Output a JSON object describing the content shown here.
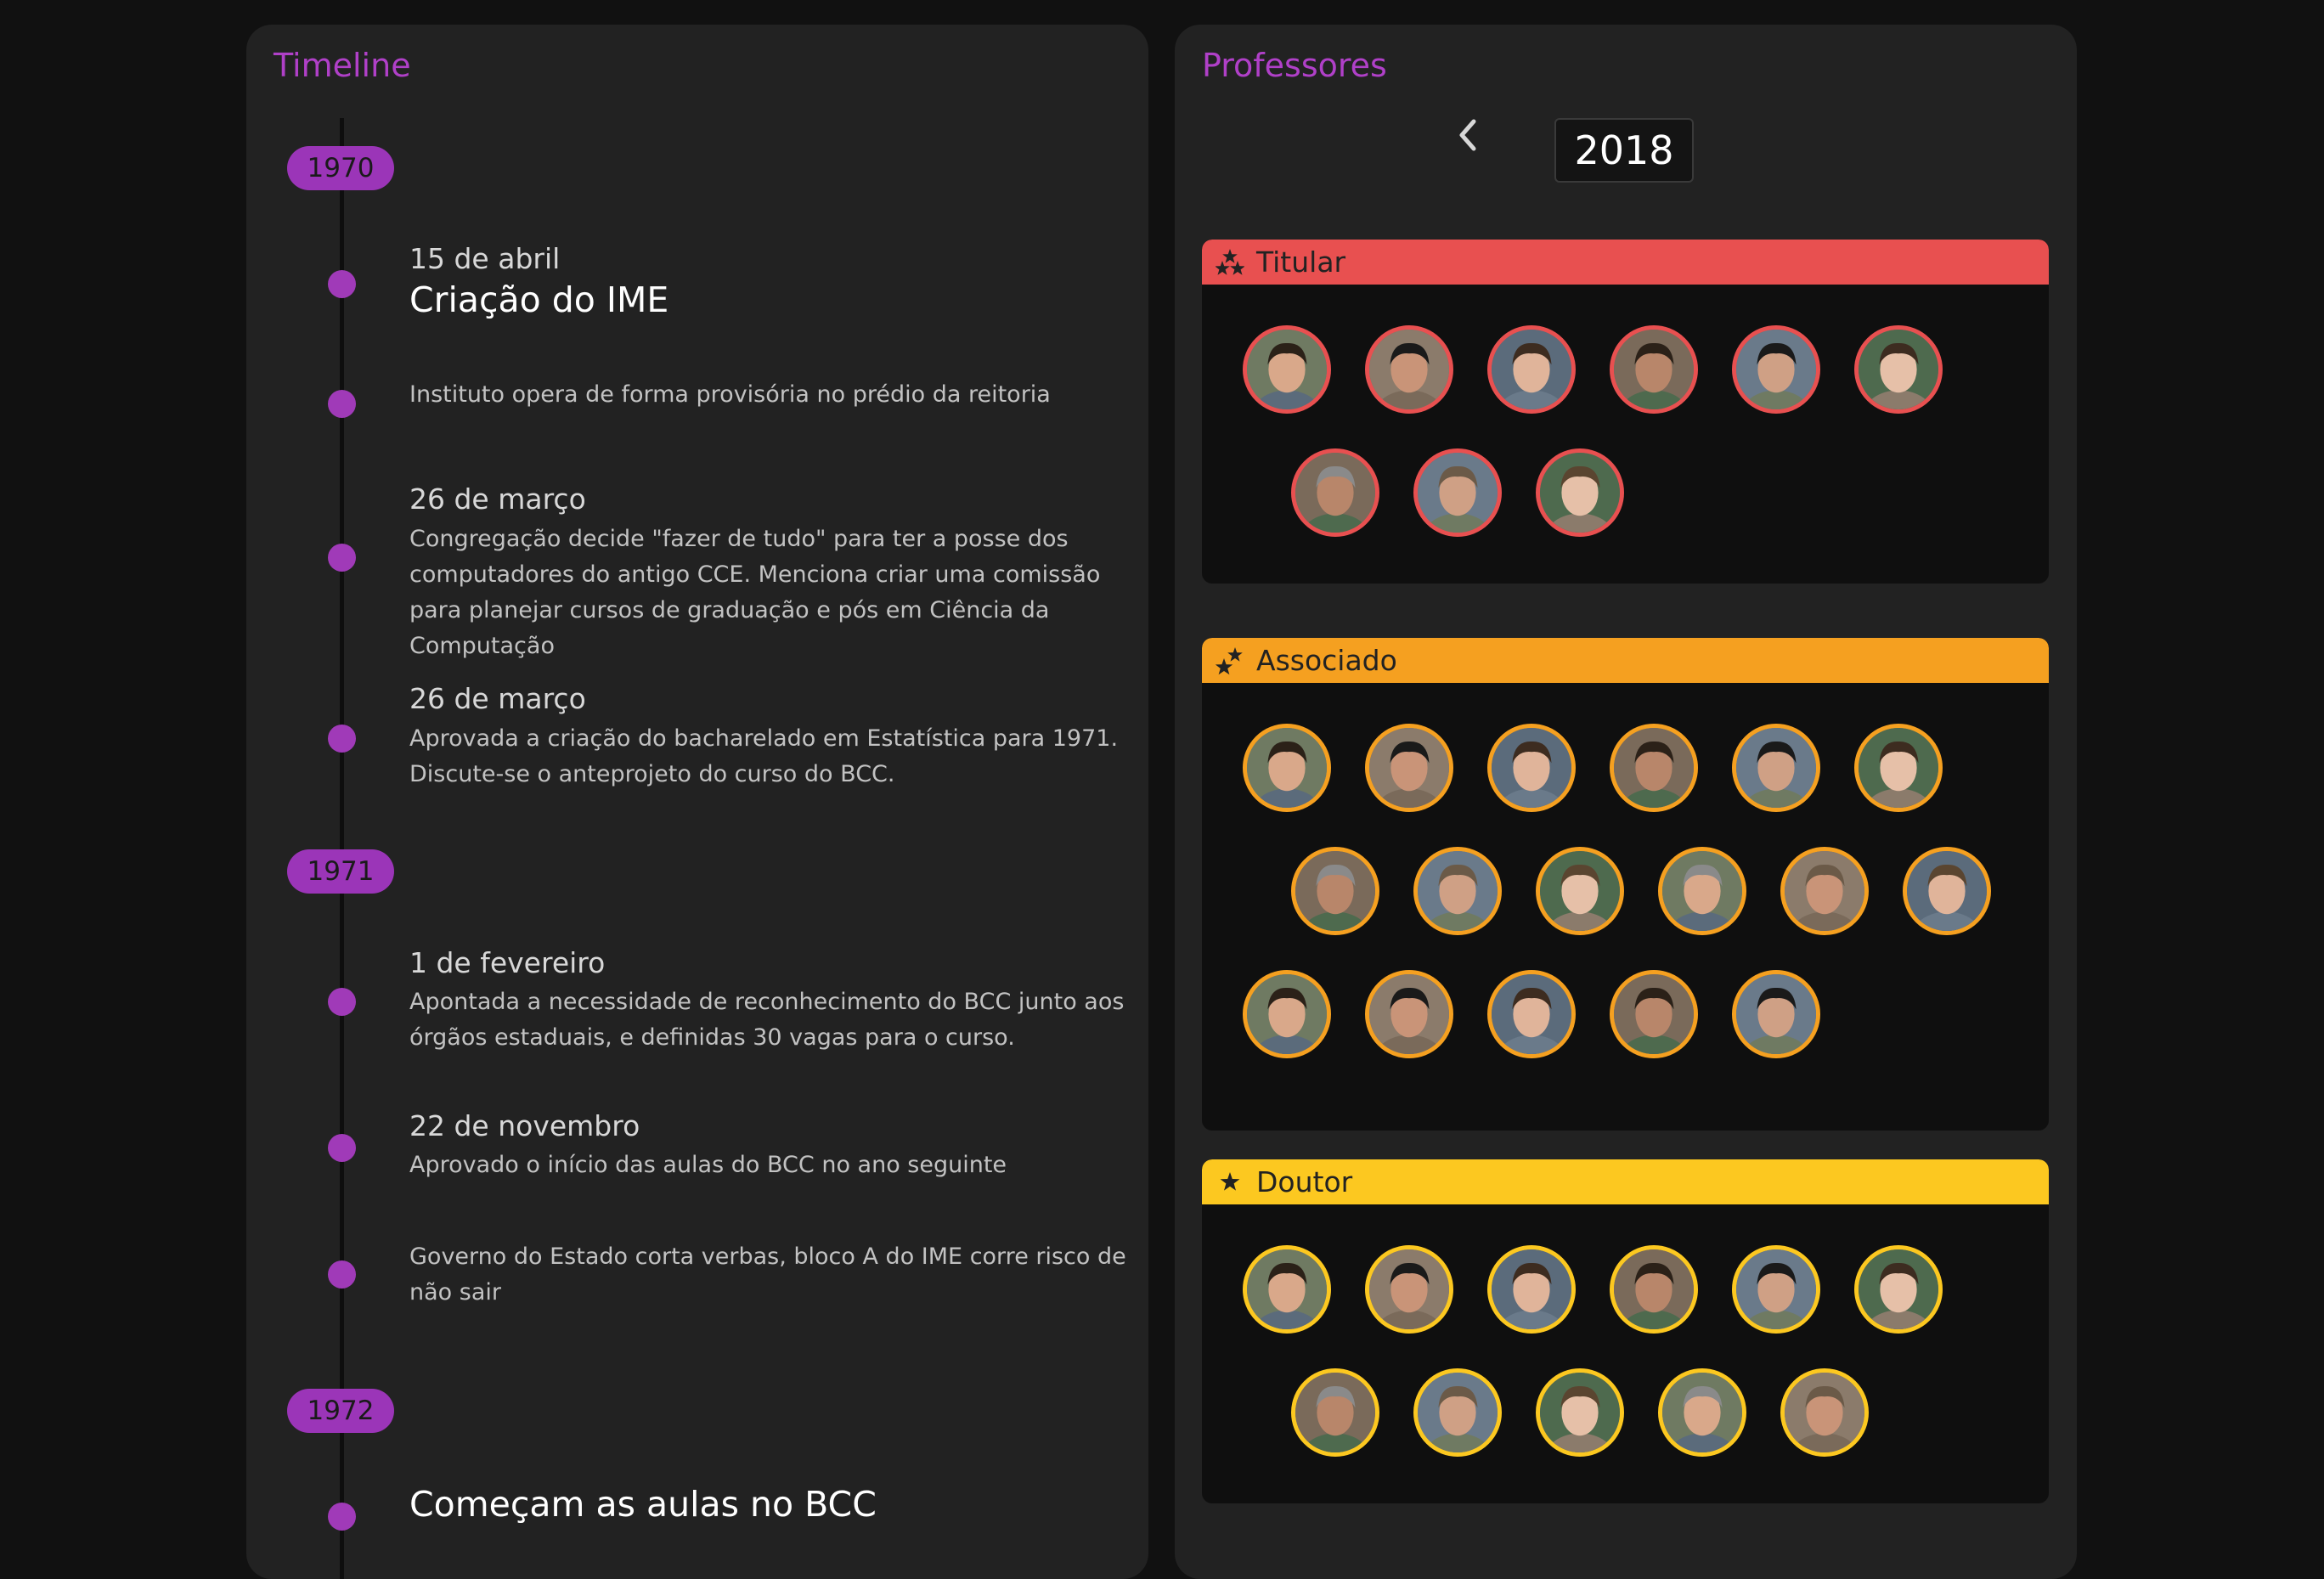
{
  "timeline": {
    "title": "Timeline",
    "years": [
      "1970",
      "1971",
      "1972"
    ],
    "events": [
      {
        "date": "15 de abril",
        "title": "Criação do IME",
        "text": ""
      },
      {
        "date": "",
        "title": "",
        "text": "Instituto opera de forma provisória no prédio da reitoria"
      },
      {
        "date": "26 de março",
        "title": "",
        "text": "Congregação decide \"fazer de tudo\" para ter a posse dos computadores do antigo CCE. Menciona criar uma comissão para planejar cursos de graduação e pós em Ciência da Computação"
      },
      {
        "date": "26 de março",
        "title": "",
        "text": "Aprovada a criação do bacharelado em Estatística para 1971. Discute-se o anteprojeto do curso do BCC."
      },
      {
        "date": "1 de fevereiro",
        "title": "",
        "text": "Apontada a necessidade de reconhecimento do BCC junto aos órgãos estaduais, e definidas 30 vagas para o curso."
      },
      {
        "date": "22 de novembro",
        "title": "",
        "text": "Aprovado o início das aulas do BCC no ano seguinte"
      },
      {
        "date": "",
        "title": "",
        "text": "Governo do Estado corta verbas, bloco A do IME corre risco de não sair"
      },
      {
        "date": "",
        "title": "Começam as aulas no BCC",
        "text": ""
      }
    ]
  },
  "professors": {
    "title": "Professores",
    "year": "2018",
    "prev_icon": "chevron-left-icon",
    "ranks": [
      {
        "name": "Titular",
        "icon": "three-stars-icon",
        "color": "#e85050",
        "count": 9
      },
      {
        "name": "Associado",
        "icon": "two-stars-icon",
        "color": "#f5a020",
        "count": 17
      },
      {
        "name": "Doutor",
        "icon": "star-icon",
        "color": "#fcc820",
        "count": 11
      }
    ]
  },
  "colors": {
    "accent": "#b040c8",
    "background": "#111111",
    "panel": "#222222"
  }
}
